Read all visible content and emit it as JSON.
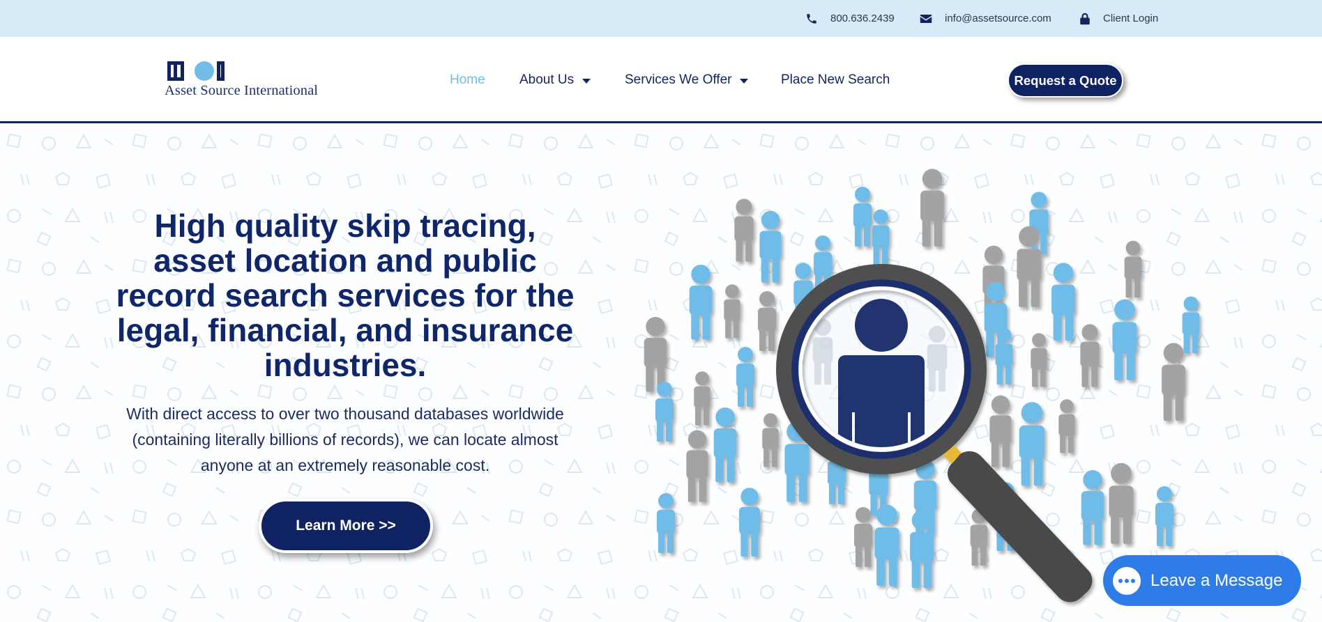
{
  "topbar": {
    "phone": {
      "icon": "phone-icon",
      "text": "800.636.2439"
    },
    "email": {
      "icon": "envelope-icon",
      "text": "info@assetsource.com"
    },
    "login": {
      "icon": "lock-icon",
      "text": "Client Login"
    }
  },
  "logo": {
    "text": "Asset Source International"
  },
  "nav": {
    "items": [
      {
        "label": "Home",
        "active": true
      },
      {
        "label": "About Us",
        "dropdown": true
      },
      {
        "label": "Services We Offer",
        "dropdown": true
      },
      {
        "label": "Place New Search"
      }
    ],
    "cta": "Request a Quote"
  },
  "hero": {
    "headline": "High quality skip tracing, asset location and public record search services for the legal, financial, and insurance industries.",
    "subtext": "With direct access to over two thousand databases worldwide (containing literally billions of records), we can locate almost anyone at an extremely reasonable cost.",
    "button": "Learn More >>"
  },
  "chat": {
    "label": "Leave a Message",
    "icon": "chat-bubble-icon"
  },
  "colors": {
    "navy": "#0f2363",
    "light_blue": "#72bce8",
    "topbar_bg": "#d6ebf8",
    "person_blue": "#6fbce8",
    "person_gray": "#a3a3a3",
    "chat_blue": "#2e7ce8"
  }
}
